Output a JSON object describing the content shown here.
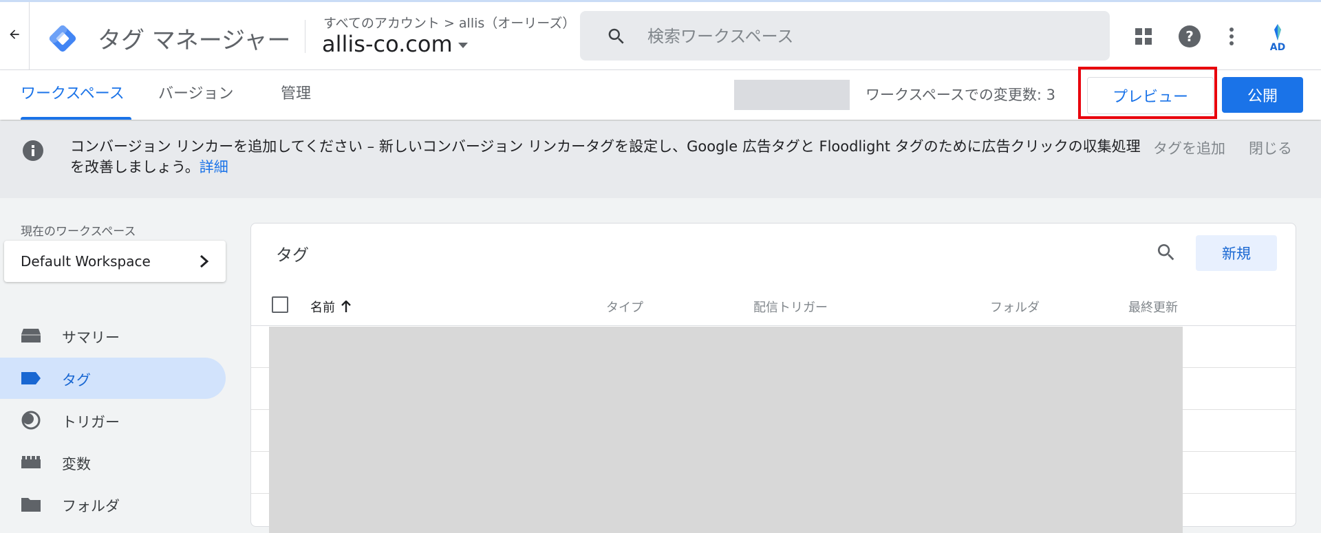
{
  "header": {
    "back_icon": "back-arrow-icon",
    "product_name": "タグ マネージャー",
    "breadcrumb": "すべてのアカウント > allis（オーリーズ）",
    "container_name": "allis-co.com",
    "search_placeholder": "検索ワークスペース",
    "icons": [
      "apps-grid-icon",
      "help-icon",
      "more-vert-icon"
    ],
    "avatar_text": "AD"
  },
  "tabs": [
    {
      "label": "ワークスペース",
      "active": true
    },
    {
      "label": "バージョン",
      "active": false
    },
    {
      "label": "管理",
      "active": false
    }
  ],
  "toolbar": {
    "changes_label": "ワークスペースでの変更数: 3",
    "preview_label": "プレビュー",
    "publish_label": "公開"
  },
  "notice": {
    "text": "コンバージョン リンカーを追加してください – 新しいコンバージョン リンカータグを設定し、Google 広告タグと Floodlight タグのために広告クリックの収集処理を改善しましょう。",
    "link": "詳細",
    "add_tag": "タグを追加",
    "close": "閉じる"
  },
  "sidebar": {
    "workspace_label": "現在のワークスペース",
    "workspace_name": "Default Workspace",
    "items": [
      {
        "label": "サマリー",
        "icon": "summary-icon"
      },
      {
        "label": "タグ",
        "icon": "tag-icon",
        "active": true
      },
      {
        "label": "トリガー",
        "icon": "trigger-icon"
      },
      {
        "label": "変数",
        "icon": "variables-icon"
      },
      {
        "label": "フォルダ",
        "icon": "folder-icon"
      }
    ]
  },
  "main": {
    "title": "タグ",
    "new_label": "新規",
    "columns": [
      "名前",
      "タイプ",
      "配信トリガー",
      "フォルダ",
      "最終更新"
    ]
  },
  "colors": {
    "accent": "#1a73e8",
    "highlight_box": "#e8000c",
    "active_nav_bg": "#d2e3fc"
  }
}
